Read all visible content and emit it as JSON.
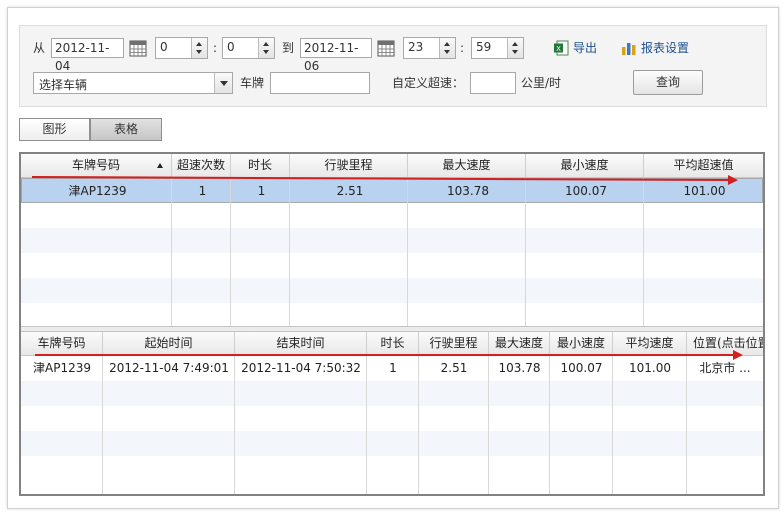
{
  "filter": {
    "from_label": "从",
    "start_date": "2012-11-04",
    "start_hour": "0",
    "start_minute": "0",
    "colon": ":",
    "to_label": "到",
    "end_date": "2012-11-06",
    "end_hour": "23",
    "end_minute": "59",
    "export_label": "导出",
    "report_settings_label": "报表设置",
    "vehicle_select": "选择车辆",
    "plate_label": "车牌",
    "plate_value": "",
    "custom_speed_label": "自定义超速：",
    "custom_speed_value": "",
    "speed_unit": "公里/时",
    "query_label": "查询"
  },
  "tabs": [
    {
      "label": "图形"
    },
    {
      "label": "表格"
    }
  ],
  "summary_table": {
    "columns": [
      "车牌号码",
      "超速次数",
      "时长",
      "行驶里程",
      "最大速度",
      "最小速度",
      "平均超速值"
    ],
    "rows": [
      [
        "津AP1239",
        "1",
        "1",
        "2.51",
        "103.78",
        "100.07",
        "101.00"
      ]
    ]
  },
  "detail_table": {
    "columns": [
      "车牌号码",
      "起始时间",
      "结束时间",
      "时长",
      "行驶里程",
      "最大速度",
      "最小速度",
      "平均速度",
      "位置(点击位置"
    ],
    "rows": [
      [
        "津AP1239",
        "2012-11-04 7:49:01",
        "2012-11-04 7:50:32",
        "1",
        "2.51",
        "103.78",
        "100.07",
        "101.00",
        "北京市 ..."
      ]
    ]
  },
  "colors": {
    "selected_row": "#b8d2f0",
    "annotation_arrow": "#d41f1f",
    "link": "#1d4f91"
  }
}
